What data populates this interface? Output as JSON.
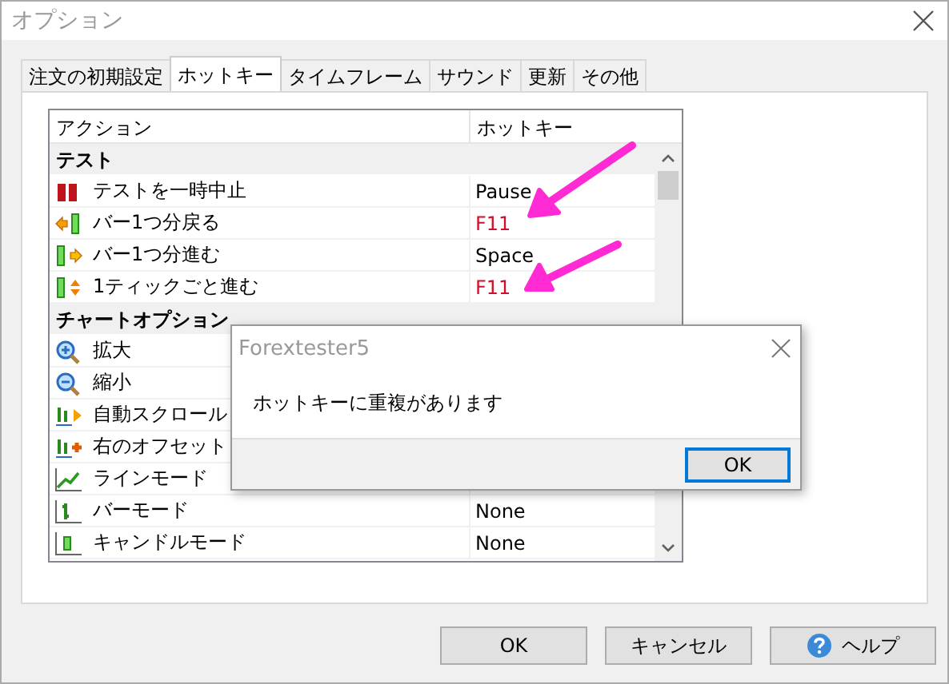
{
  "window": {
    "title": "オプション"
  },
  "tabs": [
    {
      "label": "注文の初期設定",
      "selected": false
    },
    {
      "label": "ホットキー",
      "selected": true
    },
    {
      "label": "タイムフレーム",
      "selected": false
    },
    {
      "label": "サウンド",
      "selected": false
    },
    {
      "label": "更新",
      "selected": false
    },
    {
      "label": "その他",
      "selected": false
    }
  ],
  "table": {
    "columns": [
      "アクション",
      "ホットキー"
    ],
    "groups": [
      {
        "name": "テスト",
        "rows": [
          {
            "action": "テストを一時中止",
            "hotkey": "Pause",
            "conflict": false
          },
          {
            "action": "バー1つ分戻る",
            "hotkey": "F11",
            "conflict": true
          },
          {
            "action": "バー1つ分進む",
            "hotkey": "Space",
            "conflict": false
          },
          {
            "action": "1ティックごと進む",
            "hotkey": "F11",
            "conflict": true
          }
        ]
      },
      {
        "name": "チャートオプション",
        "rows": [
          {
            "action": "拡大"
          },
          {
            "action": "縮小"
          },
          {
            "action": "自動スクロール"
          },
          {
            "action": "右のオフセット"
          },
          {
            "action": "ラインモード"
          },
          {
            "action": "バーモード",
            "hotkey": "None",
            "conflict": false
          },
          {
            "action": "キャンドルモード",
            "hotkey": "None",
            "conflict": false
          }
        ]
      }
    ]
  },
  "message_box": {
    "title": "Forextester5",
    "message": "ホットキーに重複があります",
    "button": {
      "label": "OK",
      "focused": true
    }
  },
  "buttons": [
    {
      "kind": "ok",
      "label": "OK"
    },
    {
      "kind": "cancel",
      "label": "キャンセル"
    },
    {
      "kind": "help",
      "label": "ヘルプ"
    }
  ]
}
